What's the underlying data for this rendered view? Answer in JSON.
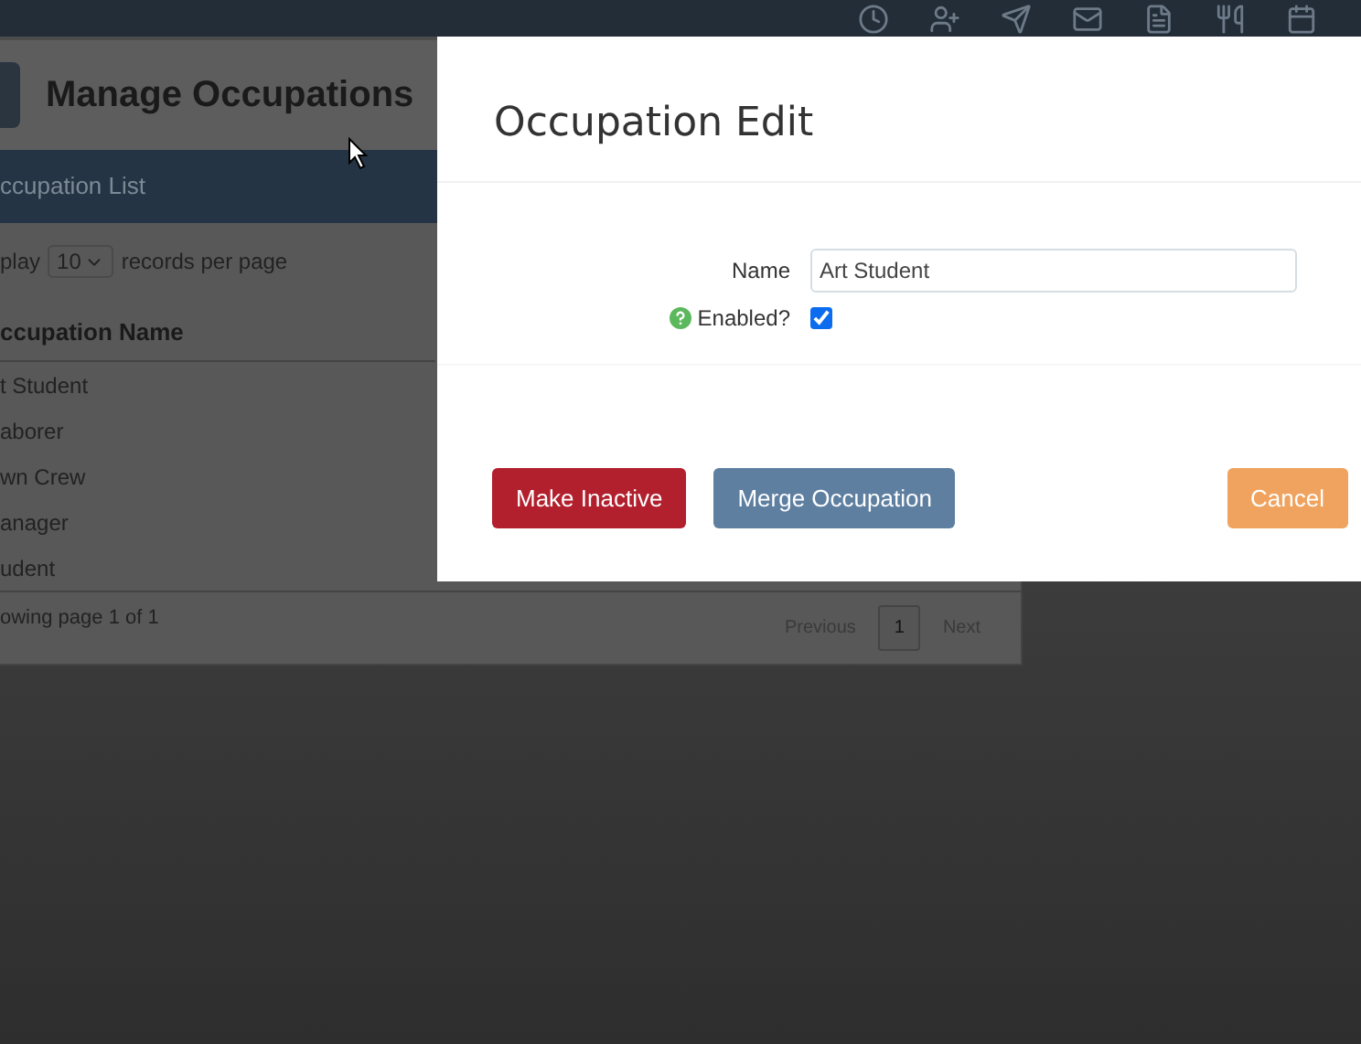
{
  "page": {
    "title": "Manage Occupations",
    "panel_heading": "ccupation List",
    "length_menu": {
      "prefix": "play",
      "value": "10",
      "suffix": "records per page"
    },
    "table": {
      "columns": [
        "ccupation Name"
      ],
      "rows": [
        [
          "t Student"
        ],
        [
          "aborer"
        ],
        [
          "wn Crew"
        ],
        [
          "anager"
        ],
        [
          "udent"
        ]
      ]
    },
    "info": "owing page 1 of 1",
    "pagination": [
      {
        "label": "Previous",
        "selected": false
      },
      {
        "label": "1",
        "selected": true
      },
      {
        "label": "Next",
        "selected": false
      }
    ]
  },
  "modal": {
    "title": "Occupation Edit",
    "name_field": {
      "label": "Name",
      "value": "Art Student"
    },
    "enabled_field": {
      "label": "Enabled?",
      "checked": true
    },
    "buttons": [
      {
        "label": "Make Inactive",
        "kind": "danger"
      },
      {
        "label": "Merge Occupation",
        "kind": "secondary"
      },
      {
        "label": "Cancel",
        "kind": "cancel"
      }
    ]
  }
}
